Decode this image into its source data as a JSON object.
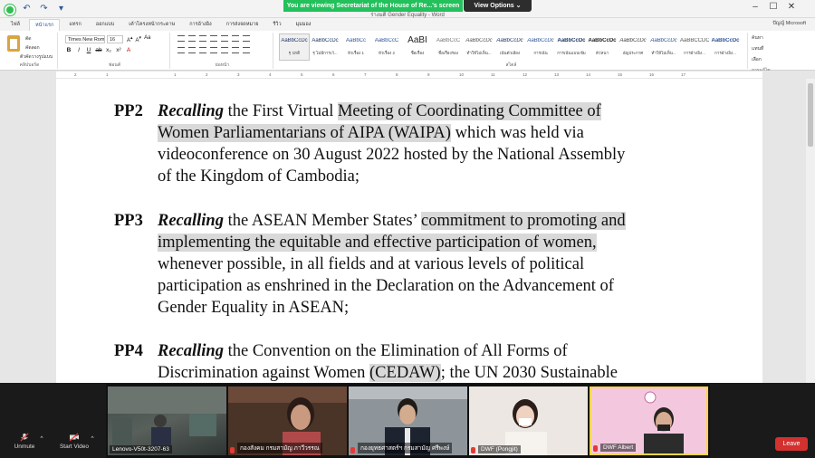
{
  "zoom": {
    "share_banner": "You are viewing Secretariat of the House of Re...'s screen",
    "view_options": "View Options ⌄",
    "unmute_label": "Unmute",
    "start_video_label": "Start Video",
    "leave_label": "Leave"
  },
  "word": {
    "doc_title": "ร่างมติ Gender Equality - Word",
    "user": "ปัญญ์ Microsoft",
    "tabs": [
      "ไฟล์",
      "หน้าแรก",
      "แทรก",
      "ออกแบบ",
      "เค้าโครงหน้ากระดาษ",
      "การอ้างอิง",
      "การส่งจดหมาย",
      "รีวิว",
      "มุมมอง"
    ],
    "active_tab_index": 1,
    "clipboard": {
      "cut": "ตัด",
      "copy": "คัดลอก",
      "format_painter": "ตัวคัดวางรูปแบบ",
      "label": "คลิปบอร์ด"
    },
    "font_name": "Times New Roman",
    "font_size": "16",
    "font_group_label": "ฟอนต์",
    "paragraph_group_label": "ย่อหน้า",
    "styles_group_label": "สไตล์",
    "styles": [
      {
        "sample": "AaBbCcDc",
        "name": "¶ ปกติ"
      },
      {
        "sample": "AaBbCcDc",
        "name": "¶ ไม่มีการเว้..."
      },
      {
        "sample": "AaBbCc",
        "name": "หัวเรื่อง 1"
      },
      {
        "sample": "AaBbCcC",
        "name": "หัวเรื่อง 2"
      },
      {
        "sample": "AaBI",
        "name": "ชื่อเรื่อง"
      },
      {
        "sample": "AaBbCcC",
        "name": "ชื่อเรื่องรอง"
      },
      {
        "sample": "AaBbCcDc",
        "name": "ทำให้ไม่เห็น..."
      },
      {
        "sample": "AaBbCcDc",
        "name": "เน้นตัวเอียง"
      },
      {
        "sample": "AaBbCcDc",
        "name": "การเน้น"
      },
      {
        "sample": "AaBbCcDc",
        "name": "การเน้นแบบเข้ม"
      },
      {
        "sample": "AaBbCcDc",
        "name": "ตัวหนา"
      },
      {
        "sample": "AaBbCcDc",
        "name": "อัญประกาศ"
      },
      {
        "sample": "AaBbCcDc",
        "name": "ทำให้ไม่เห็น..."
      },
      {
        "sample": "AaBBCCDC",
        "name": "การอ้างอิง..."
      },
      {
        "sample": "AaBbCcDc",
        "name": "การอ้างอิง..."
      },
      {
        "sample": "AaBbCcDc",
        "name": "ชื่อหนังสือ"
      }
    ],
    "editing": {
      "find": "ค้นหา",
      "replace": "แทนที่",
      "select": "เลือก",
      "label": "การแก้ไข"
    },
    "ruler_numbers": [
      "2",
      "1",
      "1",
      "2",
      "3",
      "4",
      "5",
      "6",
      "7",
      "8",
      "9",
      "10",
      "11",
      "12",
      "13",
      "14",
      "15",
      "16",
      "17"
    ]
  },
  "document": {
    "pp2": {
      "label": "PP2",
      "lines": [
        {
          "italic": "Recalling",
          "a": " the First Virtual ",
          "hl": "Meeting of Coordinating Committee of",
          "b": ""
        },
        {
          "italic": "",
          "a": "",
          "hl": "Women Parliamentarians of AIPA (WAIPA)",
          "b": " which was held via"
        },
        {
          "italic": "",
          "a": "videoconference on 30 August 2022 hosted by the National Assembly",
          "hl": "",
          "b": ""
        },
        {
          "italic": "",
          "a": "of the Kingdom of Cambodia;",
          "hl": "",
          "b": ""
        }
      ]
    },
    "pp3": {
      "label": "PP3",
      "lines": [
        {
          "italic": "Recalling",
          "a": " the ASEAN Member States’ ",
          "hl": "commitment to promoting and",
          "b": ""
        },
        {
          "italic": "",
          "a": "",
          "hl": "implementing the equitable and effective participation of women,",
          "b": ""
        },
        {
          "italic": "",
          "a": "whenever possible, in all fields and at various levels of political",
          "hl": "",
          "b": ""
        },
        {
          "italic": "",
          "a": "participation as enshrined in the Declaration on the Advancement of",
          "hl": "",
          "b": ""
        },
        {
          "italic": "",
          "a": "Gender Equality in ASEAN;",
          "hl": "",
          "b": ""
        }
      ]
    },
    "pp4": {
      "label": "PP4",
      "lines": [
        {
          "italic": "Recalling",
          "a": " the Convention on the Elimination of All Forms of",
          "hl": "",
          "b": ""
        },
        {
          "italic": "",
          "a": "Discrimination against Women ",
          "hl": "(CEDAW)",
          "b": "; the UN 2030 Sustainable"
        }
      ]
    }
  },
  "participants": [
    {
      "name": "Lenovo-V50t-3207-63"
    },
    {
      "name": "กองสังคม กรมสามัญ ภาวีวรรณ"
    },
    {
      "name": "กองยุทธศาสตร์ฯ กรมสามัญ ศรีพงษ์"
    },
    {
      "name": "DWF (Pongjit)"
    },
    {
      "name": "DWF Albert"
    }
  ]
}
